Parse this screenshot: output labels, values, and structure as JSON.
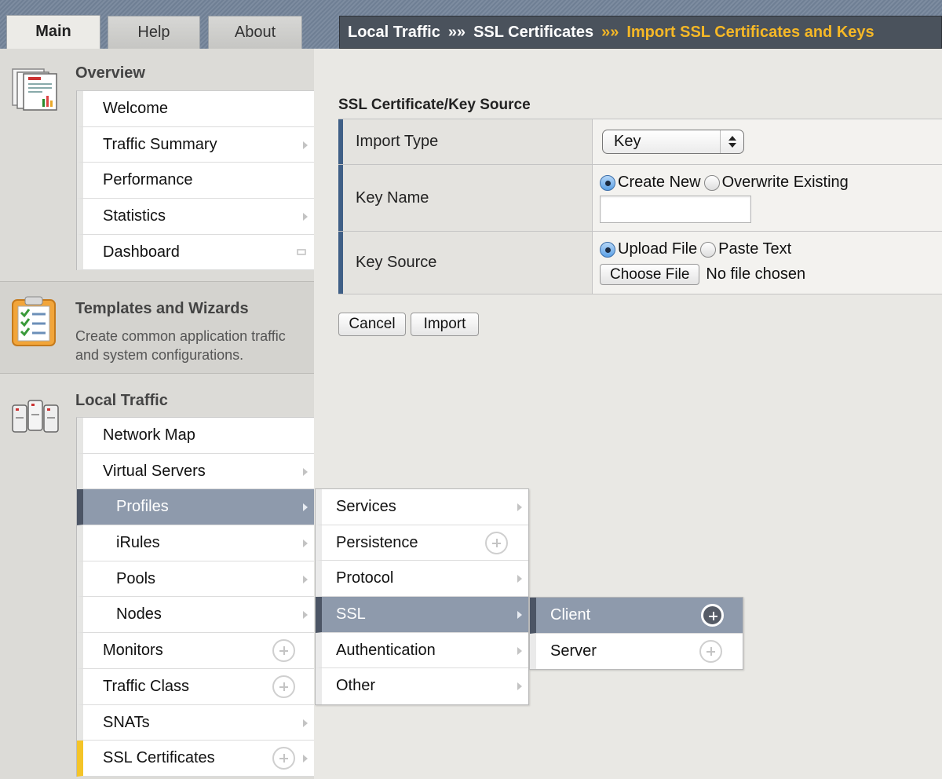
{
  "tabs": [
    {
      "label": "Main",
      "active": true
    },
    {
      "label": "Help",
      "active": false
    },
    {
      "label": "About",
      "active": false
    }
  ],
  "breadcrumb": {
    "items": [
      "Local Traffic",
      "SSL Certificates",
      "Import SSL Certificates and Keys"
    ],
    "separator": "»»"
  },
  "sidebar": {
    "overview": {
      "title": "Overview",
      "items": [
        "Welcome",
        "Traffic Summary",
        "Performance",
        "Statistics",
        "Dashboard"
      ]
    },
    "templates": {
      "title": "Templates and Wizards",
      "description": "Create common application traffic and system configurations."
    },
    "local_traffic": {
      "title": "Local Traffic",
      "items": [
        "Network Map",
        "Virtual Servers",
        "Profiles",
        "iRules",
        "Pools",
        "Nodes",
        "Monitors",
        "Traffic Class",
        "SNATs",
        "SSL Certificates"
      ]
    }
  },
  "profiles_flyout": {
    "items": [
      "Services",
      "Persistence",
      "Protocol",
      "SSL",
      "Authentication",
      "Other"
    ]
  },
  "ssl_flyout": {
    "items": [
      "Client",
      "Server"
    ]
  },
  "form": {
    "title": "SSL Certificate/Key Source",
    "import_type": {
      "label": "Import Type",
      "value": "Key"
    },
    "key_name": {
      "label": "Key Name",
      "option_new": "Create New",
      "option_overwrite": "Overwrite Existing",
      "value": ""
    },
    "key_source": {
      "label": "Key Source",
      "option_upload": "Upload File",
      "option_paste": "Paste Text",
      "file_button": "Choose File",
      "file_status": "No file chosen"
    },
    "cancel_label": "Cancel",
    "import_label": "Import"
  },
  "colors": {
    "accent_breadcrumb_current": "#f6b826",
    "selected_menu": "#8e9aac",
    "form_label_bar": "#3f5f86"
  }
}
